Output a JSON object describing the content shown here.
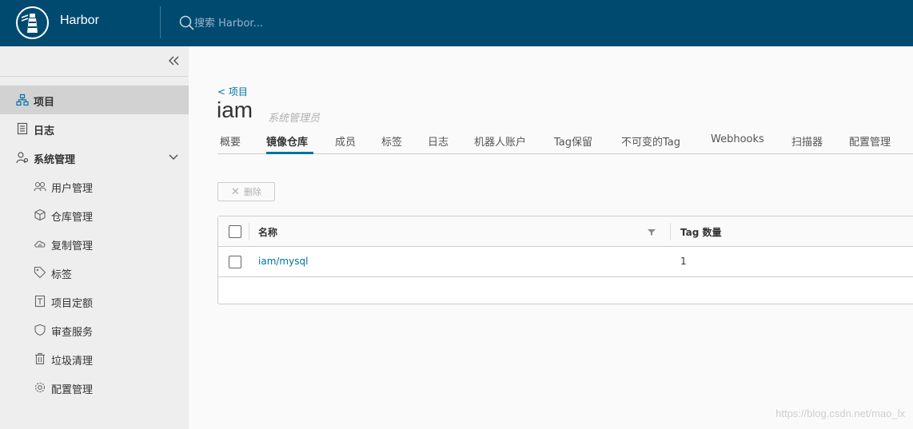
{
  "header": {
    "brand": "Harbor",
    "search_placeholder": "搜索 Harbor..."
  },
  "sidebar": {
    "items": [
      {
        "label": "项目",
        "icon": "projects-icon",
        "active": true
      },
      {
        "label": "日志",
        "icon": "logs-icon",
        "active": false
      },
      {
        "label": "系统管理",
        "icon": "admin-icon",
        "active": false
      }
    ],
    "admin_items": [
      {
        "label": "用户管理",
        "icon": "users-icon"
      },
      {
        "label": "仓库管理",
        "icon": "registry-icon"
      },
      {
        "label": "复制管理",
        "icon": "replication-icon"
      },
      {
        "label": "标签",
        "icon": "tag-icon"
      },
      {
        "label": "项目定额",
        "icon": "quota-icon"
      },
      {
        "label": "审查服务",
        "icon": "shield-icon"
      },
      {
        "label": "垃圾清理",
        "icon": "trash-icon"
      },
      {
        "label": "配置管理",
        "icon": "gear-icon"
      }
    ]
  },
  "main": {
    "breadcrumb": "< 项目",
    "title": "iam",
    "role": "系统管理员",
    "tabs": [
      "概要",
      "镜像仓库",
      "成员",
      "标签",
      "日志",
      "机器人账户",
      "Tag保留",
      "不可变的Tag",
      "Webhooks",
      "扫描器",
      "配置管理"
    ],
    "active_tab": "镜像仓库",
    "delete_label": "删除",
    "table": {
      "columns": [
        "名称",
        "Tag 数量"
      ],
      "rows": [
        {
          "name": "iam/mysql",
          "count": "1"
        }
      ]
    }
  },
  "watermark": "https://blog.csdn.net/mao_lx",
  "colors": {
    "header_bg": "#004a70",
    "accent": "#0072a3",
    "sidebar_bg": "#eeeeee"
  }
}
